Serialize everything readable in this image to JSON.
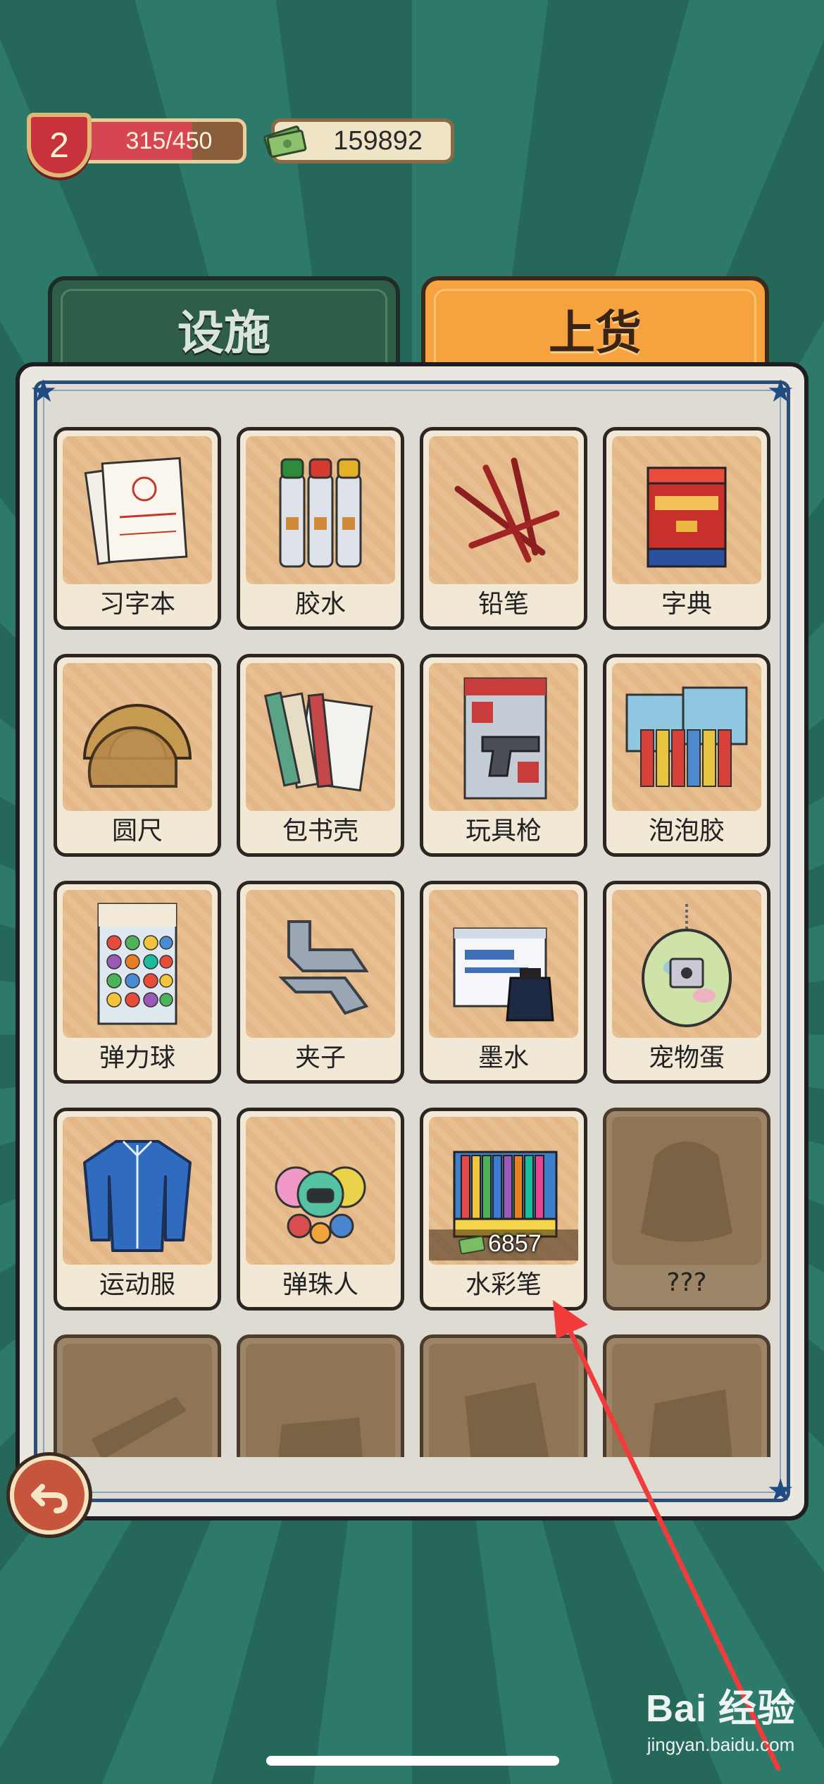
{
  "hud": {
    "level": "2",
    "xp_text": "315/450",
    "xp_progress": 0.7,
    "money": "159892"
  },
  "tabs": [
    {
      "label": "设施",
      "active": false
    },
    {
      "label": "上货",
      "active": true
    }
  ],
  "items": [
    {
      "label": "习字本",
      "icon": "copybook-icon",
      "locked": false
    },
    {
      "label": "胶水",
      "icon": "glue-icon",
      "locked": false
    },
    {
      "label": "铅笔",
      "icon": "pencil-icon",
      "locked": false
    },
    {
      "label": "字典",
      "icon": "dictionary-icon",
      "locked": false
    },
    {
      "label": "圆尺",
      "icon": "protractor-icon",
      "locked": false
    },
    {
      "label": "包书壳",
      "icon": "book-cover-icon",
      "locked": false
    },
    {
      "label": "玩具枪",
      "icon": "toy-gun-icon",
      "locked": false
    },
    {
      "label": "泡泡胶",
      "icon": "bubble-gum-icon",
      "locked": false
    },
    {
      "label": "弹力球",
      "icon": "bouncy-ball-icon",
      "locked": false
    },
    {
      "label": "夹子",
      "icon": "clip-icon",
      "locked": false
    },
    {
      "label": "墨水",
      "icon": "ink-icon",
      "locked": false
    },
    {
      "label": "宠物蛋",
      "icon": "tamagotchi-icon",
      "locked": false
    },
    {
      "label": "运动服",
      "icon": "tracksuit-icon",
      "locked": false
    },
    {
      "label": "弹珠人",
      "icon": "bomberman-toy-icon",
      "locked": false
    },
    {
      "label": "水彩笔",
      "icon": "markers-icon",
      "locked": false,
      "price": "6857"
    },
    {
      "label": "???",
      "icon": "unknown-item-icon",
      "locked": true
    }
  ],
  "colors": {
    "background": "#2e7a6a",
    "tab_active": "#f6a23f",
    "tab_inactive": "#2f5e48",
    "panel_border": "#2b4e78",
    "level_badge": "#c8323a",
    "annotation_arrow": "#f23b3b"
  },
  "back_button_icon": "back-arrow-icon",
  "watermark": {
    "logo": "Bai 经验",
    "url": "jingyan.baidu.com"
  }
}
